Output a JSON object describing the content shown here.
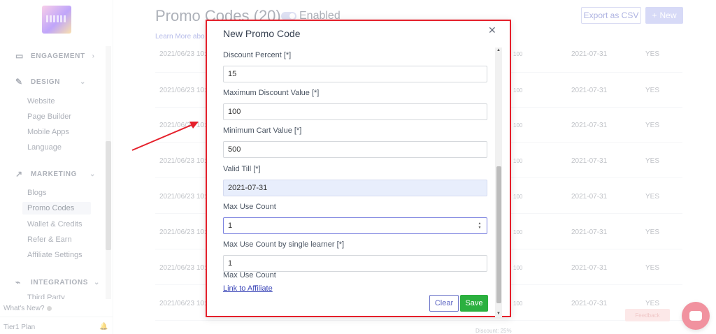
{
  "sidebar": {
    "sections": [
      {
        "label": "ENGAGEMENT",
        "icon": "chat-icon"
      },
      {
        "label": "DESIGN",
        "icon": "brush-icon"
      },
      {
        "label": "MARKETING",
        "icon": "trending-icon"
      },
      {
        "label": "INTEGRATIONS",
        "icon": "plug-icon"
      }
    ],
    "design_items": [
      "Website",
      "Page Builder",
      "Mobile Apps",
      "Language"
    ],
    "marketing_items": [
      "Blogs",
      "Promo Codes",
      "Wallet & Credits",
      "Refer & Earn",
      "Affiliate Settings"
    ],
    "integration_items": [
      "Third Party"
    ],
    "whats_new": "What's New?",
    "plan": "Tier1 Plan"
  },
  "header": {
    "title": "Promo Codes (20)",
    "toggle_label": "Enabled",
    "learn_more": "Learn More",
    "learn_more_suffix": "abo",
    "export_button": "Export as CSV",
    "new_button": "New"
  },
  "table": {
    "rows": [
      {
        "date": "2021/06/23 10:",
        "value": "100",
        "till": "2021-07-31",
        "active": "YES"
      },
      {
        "date": "2021/06/23 10:",
        "value": "100",
        "till": "2021-07-31",
        "active": "YES"
      },
      {
        "date": "2021/06/23 10:",
        "value": "100",
        "till": "2021-07-31",
        "active": "YES"
      },
      {
        "date": "2021/06/23 10:",
        "value": "100",
        "till": "2021-07-31",
        "active": "YES"
      },
      {
        "date": "2021/06/23 10:",
        "value": "100",
        "till": "2021-07-31",
        "active": "YES"
      },
      {
        "date": "2021/06/23 10:",
        "value": "100",
        "till": "2021-07-31",
        "active": "YES"
      },
      {
        "date": "2021/06/23 10:",
        "value": "100",
        "till": "2021-07-31",
        "active": "YES"
      },
      {
        "date": "2021/06/23 10:",
        "value": "100",
        "till": "2021-07-31",
        "active": "YES"
      }
    ],
    "discount_note": "Discount: 25%"
  },
  "feedback_label": "Feedback",
  "modal": {
    "title": "New Promo Code",
    "fields": [
      {
        "label": "Discount Percent [*]",
        "value": "15"
      },
      {
        "label": "Maximum Discount Value [*]",
        "value": "100"
      },
      {
        "label": "Minimum Cart Value [*]",
        "value": "500"
      },
      {
        "label": "Valid Till [*]",
        "value": "2021-07-31"
      },
      {
        "label": "Max Use Count",
        "value": "1"
      },
      {
        "label": "Max Use Count by single learner [*]",
        "value": "1"
      }
    ],
    "extra_label": "Max Use Count",
    "link_affiliate": "Link to Affiliate",
    "clear_button": "Clear",
    "save_button": "Save"
  },
  "colors": {
    "annotation": "#e5202b",
    "save": "#2bb03f",
    "accent": "#6b74c9"
  }
}
